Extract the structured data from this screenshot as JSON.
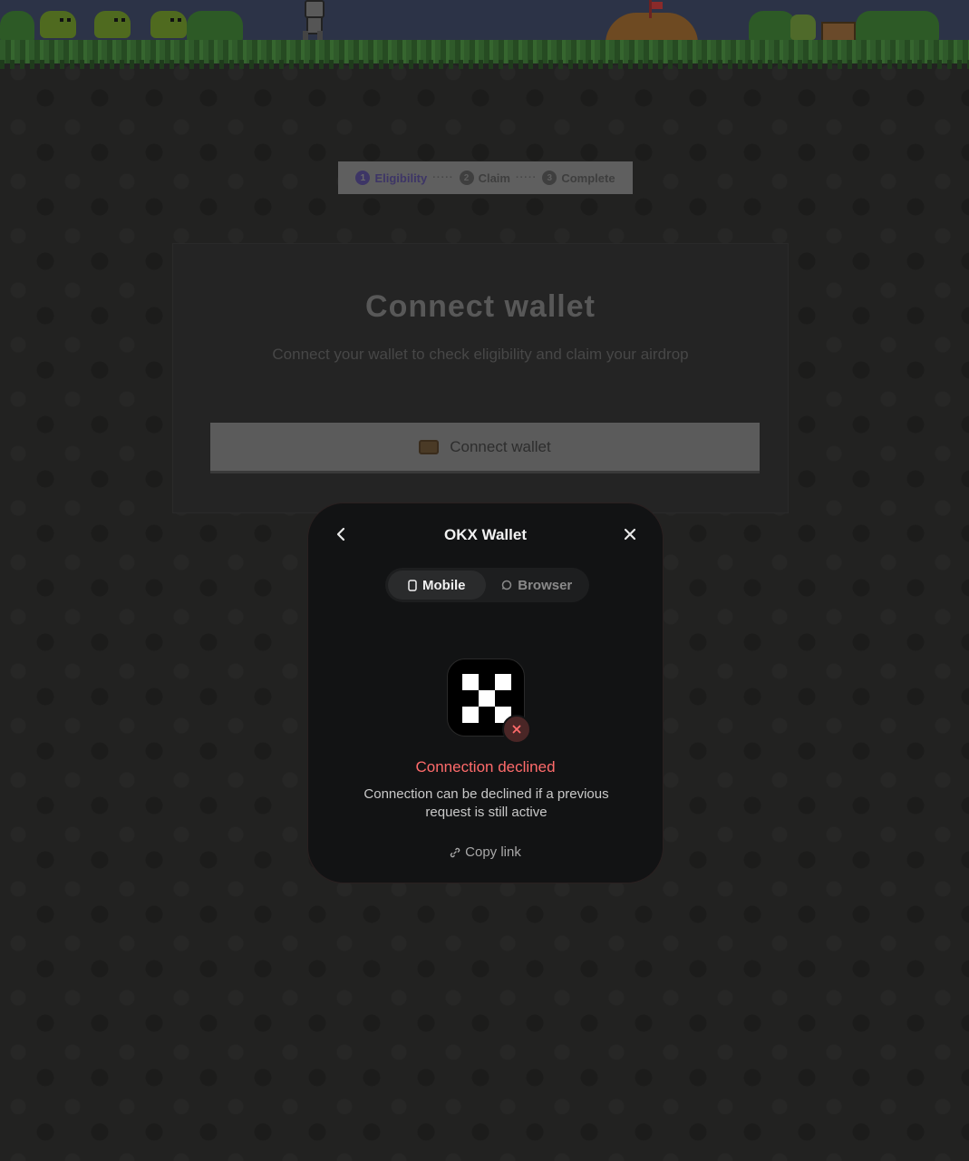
{
  "steps": [
    {
      "num": "1",
      "label": "Eligibility"
    },
    {
      "num": "2",
      "label": "Claim"
    },
    {
      "num": "3",
      "label": "Complete"
    }
  ],
  "step_separator": "·····",
  "card": {
    "title": "Connect wallet",
    "subtitle": "Connect your wallet to check eligibility and claim your airdrop",
    "button_label": "Connect wallet"
  },
  "modal": {
    "title": "OKX Wallet",
    "tabs": {
      "mobile": "Mobile",
      "browser": "Browser"
    },
    "status": "Connection declined",
    "message": "Connection can be declined if a previous request is still active",
    "copy_link": "Copy link"
  },
  "colors": {
    "error": "#ff6b6b",
    "modal_bg": "#121314",
    "active_step": "#3d3566"
  },
  "icons": {
    "back": "chevron-left-icon",
    "close": "close-icon",
    "mobile": "phone-icon",
    "browser": "globe-icon",
    "copy": "link-icon",
    "error": "x-icon",
    "wallet": "wallet-icon"
  }
}
